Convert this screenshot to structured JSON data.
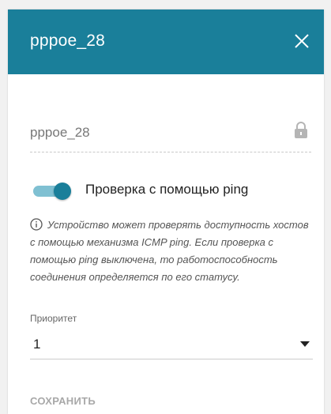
{
  "header": {
    "title": "pppoe_28",
    "close_icon": "close-icon",
    "bg_color": "#1a7f9a"
  },
  "name_field": {
    "value": "pppoe_28",
    "icon": "lock-icon"
  },
  "ping_toggle": {
    "label": "Проверка с помощью ping",
    "state": "on",
    "accent_color": "#1a7f9a"
  },
  "info": {
    "icon": "info-icon",
    "text": "Устройство может проверять доступность хостов с помощью механизма ICMP ping. Если проверка с помощью ping выключена, то работоспособность соединения определяется по его статусу."
  },
  "priority": {
    "label": "Приоритет",
    "selected": "1",
    "icon": "chevron-down-icon"
  },
  "actions": {
    "save_label": "СОХРАНИТЬ"
  }
}
